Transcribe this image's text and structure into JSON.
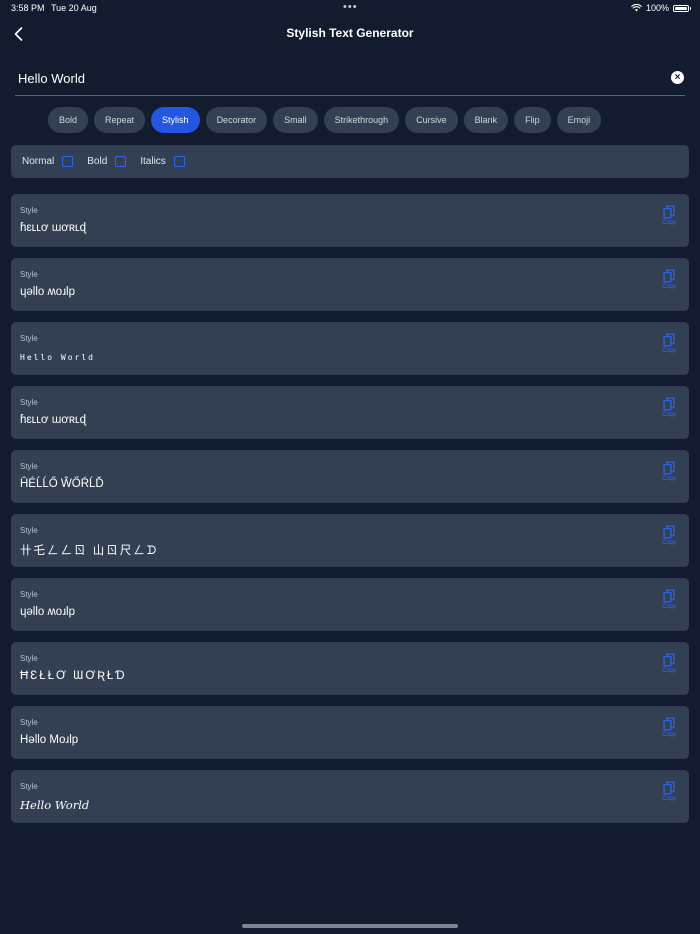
{
  "status_bar": {
    "time": "3:58 PM",
    "date": "Tue 20 Aug",
    "dots": "•••",
    "battery": "100%",
    "icons": [
      "wifi-icon",
      "battery-icon"
    ]
  },
  "nav": {
    "back_icon": "chevron-left-icon",
    "title": "Stylish Text Generator"
  },
  "input": {
    "value": "Hello World",
    "clear_icon": "x-circle-icon",
    "clear_glyph": "×"
  },
  "tabs": [
    {
      "label": "Bold",
      "active": false
    },
    {
      "label": "Repeat",
      "active": false
    },
    {
      "label": "Stylish",
      "active": true
    },
    {
      "label": "Decorator",
      "active": false
    },
    {
      "label": "Small",
      "active": false
    },
    {
      "label": "Strikethrough",
      "active": false
    },
    {
      "label": "Cursive",
      "active": false
    },
    {
      "label": "Blank",
      "active": false
    },
    {
      "label": "Flip",
      "active": false
    },
    {
      "label": "Emoji",
      "active": false
    }
  ],
  "format_options": [
    {
      "label": "Normal",
      "checked": false
    },
    {
      "label": "Bold",
      "checked": false
    },
    {
      "label": "Italics",
      "checked": false
    }
  ],
  "styles": [
    {
      "caption": "Style",
      "text": "ɦɛʟʟơ ɯơʀʟɖ",
      "copy_label": "Copy"
    },
    {
      "caption": "Style",
      "text": "ɥǝllo ʍoɹlp",
      "copy_label": "Copy"
    },
    {
      "caption": "Style",
      "text": "Hello World",
      "copy_label": "Copy"
    },
    {
      "caption": "Style",
      "text": "ɦɛʟʟơ ɯơʀʟɖ",
      "copy_label": "Copy"
    },
    {
      "caption": "Style",
      "text": "ĤÉĹĹŐ ŴŐŔĹĎ",
      "copy_label": "Copy"
    },
    {
      "caption": "Style",
      "text": "卄乇ㄥㄥㄖ 山ㄖ尺ㄥᗪ",
      "copy_label": "Copy"
    },
    {
      "caption": "Style",
      "text": "ɥǝllo ʍoɹlp",
      "copy_label": "Copy"
    },
    {
      "caption": "Style",
      "text": "ĦƐŁŁƠ ƜƠƦŁƊ",
      "copy_label": "Copy"
    },
    {
      "caption": "Style",
      "text": "Hǝllo Moɹlp",
      "copy_label": "Copy"
    },
    {
      "caption": "Style",
      "text": "Hello World",
      "copy_label": "Copy"
    }
  ],
  "colors": {
    "background": "#131c2e",
    "card": "#334053",
    "accent": "#2456e0",
    "copy_blue": "#2f66f0"
  }
}
